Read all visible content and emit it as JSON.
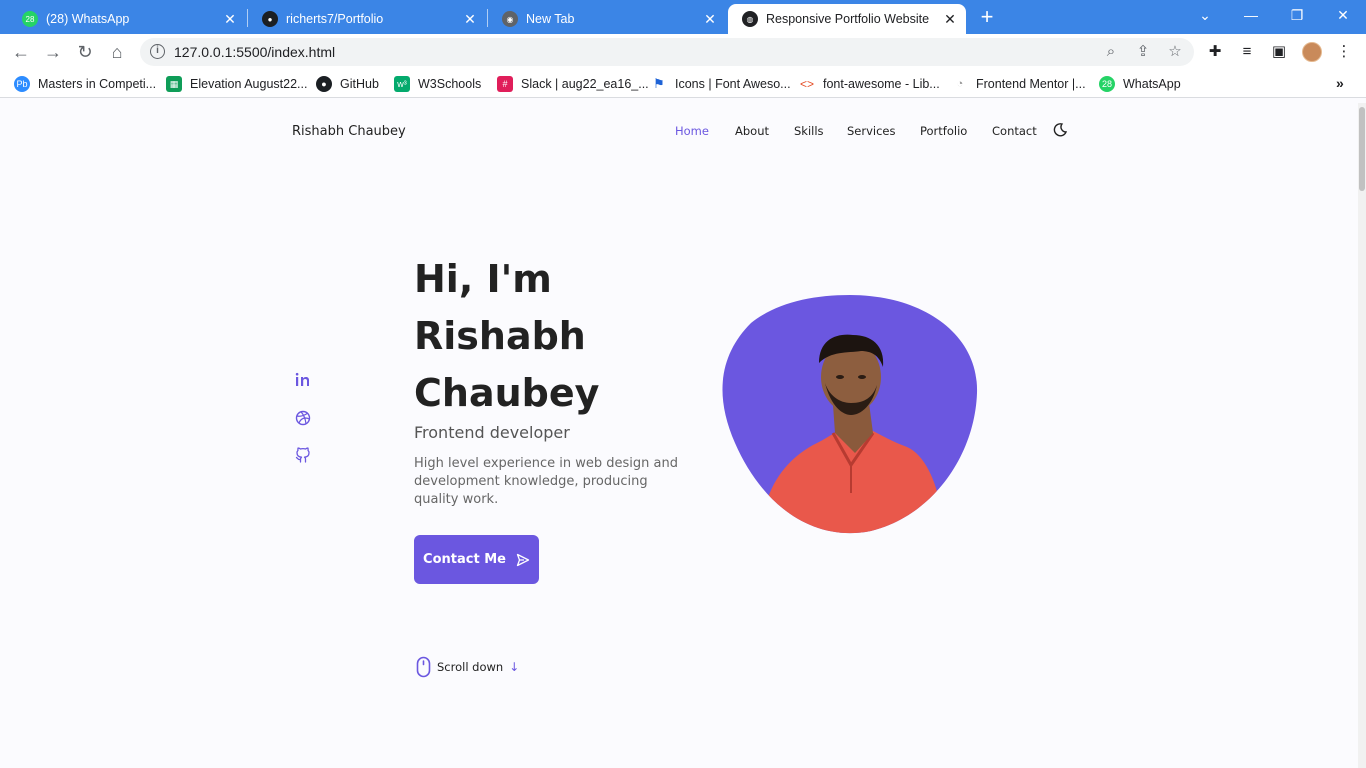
{
  "browser": {
    "tabs": [
      {
        "label": "(28) WhatsApp",
        "icon": "whatsapp-icon",
        "badge": "28"
      },
      {
        "label": "richerts7/Portfolio",
        "icon": "github-icon"
      },
      {
        "label": "New Tab",
        "icon": "chrome-icon"
      },
      {
        "label": "Responsive Portfolio Website",
        "icon": "globe-icon"
      }
    ],
    "url": "127.0.0.1:5500/index.html",
    "bookmarks": [
      {
        "label": "Masters in Competi...",
        "icon": "pb-icon",
        "icon_text": "Pb"
      },
      {
        "label": "Elevation August22...",
        "icon": "sheets-icon"
      },
      {
        "label": "GitHub",
        "icon": "github-icon"
      },
      {
        "label": "W3Schools",
        "icon": "w3schools-icon"
      },
      {
        "label": "Slack | aug22_ea16_...",
        "icon": "slack-icon"
      },
      {
        "label": "Icons | Font Aweso...",
        "icon": "flag-icon"
      },
      {
        "label": "font-awesome - Lib...",
        "icon": "code-icon"
      },
      {
        "label": "Frontend Mentor |...",
        "icon": "frontend-mentor-icon"
      },
      {
        "label": "WhatsApp",
        "icon": "whatsapp-icon",
        "badge": "28"
      }
    ]
  },
  "site": {
    "logo": "Rishabh Chaubey",
    "nav": [
      "Home",
      "About",
      "Skills",
      "Services",
      "Portfolio",
      "Contact"
    ],
    "active_nav": "Home",
    "hero": {
      "title_line1": "Hi, I'm",
      "title_line2": "Rishabh",
      "title_line3": "Chaubey",
      "subtitle": "Frontend developer",
      "description": "High level experience in web design and development knowledge, producing quality work.",
      "cta_label": "Contact Me"
    },
    "socials": [
      "linkedin-icon",
      "dribbble-icon",
      "github-icon"
    ],
    "scroll_label": "Scroll down"
  },
  "colors": {
    "accent": "#6b57e0",
    "tabbar": "#3b85e6",
    "background": "#fbfbfe",
    "shirt": "#e9584b"
  }
}
